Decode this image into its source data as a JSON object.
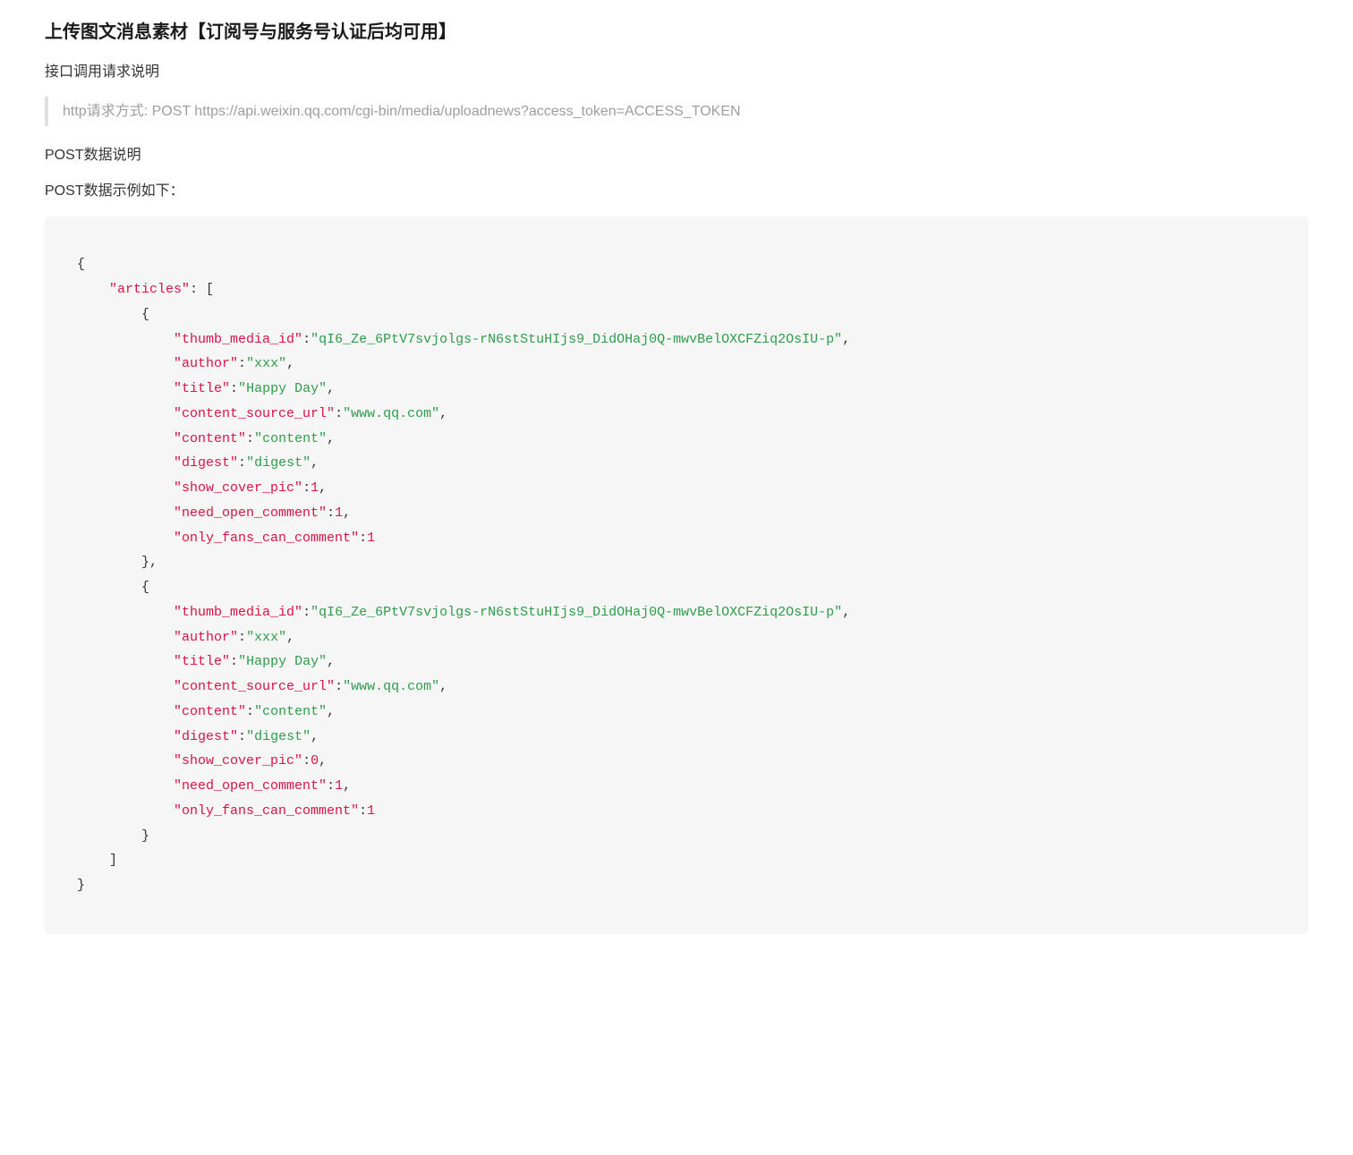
{
  "heading": "上传图文消息素材【订阅号与服务号认证后均可用】",
  "intro": "接口调用请求说明",
  "http_line": "http请求方式: POST https://api.weixin.qq.com/cgi-bin/media/uploadnews?access_token=ACCESS_TOKEN",
  "post_desc": "POST数据说明",
  "post_example_label": "POST数据示例如下：",
  "code": {
    "root_key": "articles",
    "rows": [
      {
        "k": "thumb_media_id",
        "v": "qI6_Ze_6PtV7svjolgs-rN6stStuHIjs9_DidOHaj0Q-mwvBelOXCFZiq2OsIU-p",
        "t": "str"
      },
      {
        "k": "author",
        "v": "xxx",
        "t": "str"
      },
      {
        "k": "title",
        "v": "Happy Day",
        "t": "str"
      },
      {
        "k": "content_source_url",
        "v": "www.qq.com",
        "t": "str"
      },
      {
        "k": "content",
        "v": "content",
        "t": "str"
      },
      {
        "k": "digest",
        "v": "digest",
        "t": "str"
      },
      {
        "k": "show_cover_pic",
        "v": "1",
        "t": "num"
      },
      {
        "k": "need_open_comment",
        "v": "1",
        "t": "num"
      },
      {
        "k": "only_fans_can_comment",
        "v": "1",
        "t": "num"
      }
    ],
    "rows2": [
      {
        "k": "thumb_media_id",
        "v": "qI6_Ze_6PtV7svjolgs-rN6stStuHIjs9_DidOHaj0Q-mwvBelOXCFZiq2OsIU-p",
        "t": "str"
      },
      {
        "k": "author",
        "v": "xxx",
        "t": "str"
      },
      {
        "k": "title",
        "v": "Happy Day",
        "t": "str"
      },
      {
        "k": "content_source_url",
        "v": "www.qq.com",
        "t": "str"
      },
      {
        "k": "content",
        "v": "content",
        "t": "str"
      },
      {
        "k": "digest",
        "v": "digest",
        "t": "str"
      },
      {
        "k": "show_cover_pic",
        "v": "0",
        "t": "num"
      },
      {
        "k": "need_open_comment",
        "v": "1",
        "t": "num"
      },
      {
        "k": "only_fans_can_comment",
        "v": "1",
        "t": "num"
      }
    ]
  }
}
